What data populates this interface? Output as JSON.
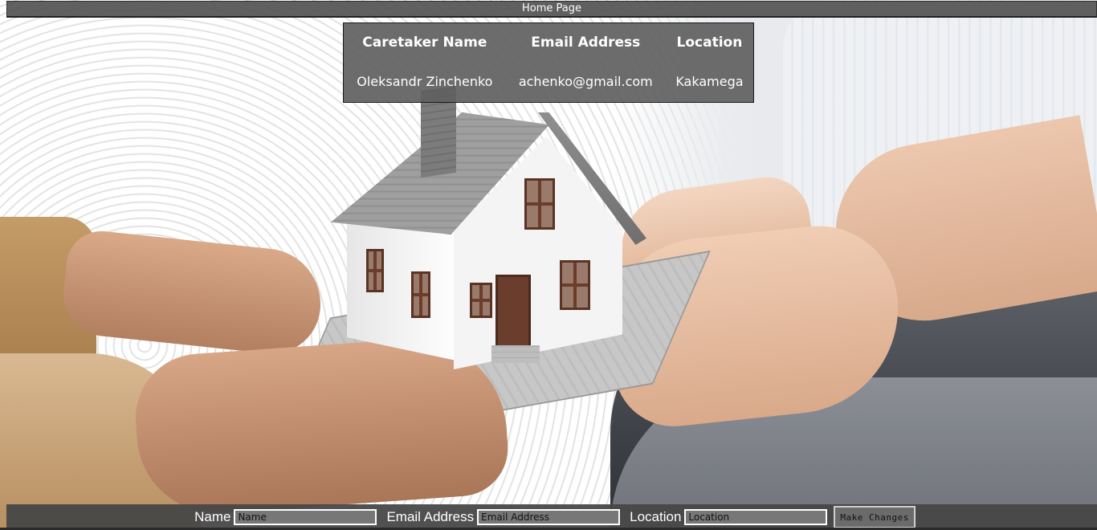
{
  "nav": {
    "home_label": "Home Page"
  },
  "caretaker_table": {
    "headers": [
      "Caretaker Name",
      "Email Address",
      "Location"
    ],
    "row": {
      "name": "Oleksandr Zinchenko",
      "email": "achenko@gmail.com",
      "location": "Kakamega"
    }
  },
  "form": {
    "name_label": "Name",
    "name_placeholder": "Name",
    "email_label": "Email Address",
    "email_placeholder": "Email Address",
    "location_label": "Location",
    "location_placeholder": "Location",
    "submit_label": "Make Changes"
  },
  "colors": {
    "bar_background": "#555555",
    "table_background": "#5f5f5f",
    "input_background": "#777777",
    "text": "#ffffff"
  }
}
